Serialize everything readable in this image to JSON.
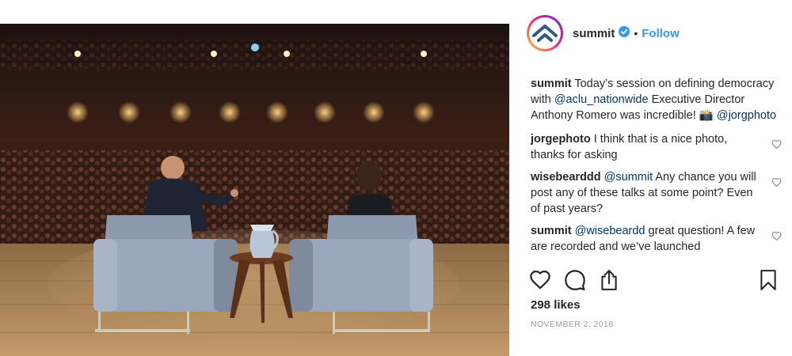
{
  "post": {
    "username": "summit",
    "follow_label": "Follow",
    "separator": "•",
    "caption": {
      "user": "summit",
      "text_1": " Today’s session on defining democracy with ",
      "mention_1": "@aclu_nationwide",
      "text_2": " Executive Director Anthony Romero was incredible! 📸 ",
      "mention_2": "@jorgphoto"
    },
    "comments": [
      {
        "user": "jorgephoto",
        "text": " I think that is a nice photo, thanks for asking"
      },
      {
        "user": "wisebearddd",
        "mention": "@summit",
        "text": " Any chance you will post any of these talks at some point? Even of past years?"
      },
      {
        "user": "summit",
        "mention": "@wisebeardd",
        "text": " great question! A few are recorded and we’ve launched"
      }
    ],
    "likes": "298 likes",
    "date": "NOVEMBER 2, 2018"
  },
  "icons": {
    "verified": "verified-badge-icon",
    "like": "heart-icon",
    "comment": "comment-icon",
    "share": "share-icon",
    "save": "bookmark-icon",
    "comment_like": "small-heart-icon"
  },
  "colors": {
    "link": "#3897f0",
    "mention": "#003569",
    "text": "#262626",
    "muted": "#999999"
  }
}
